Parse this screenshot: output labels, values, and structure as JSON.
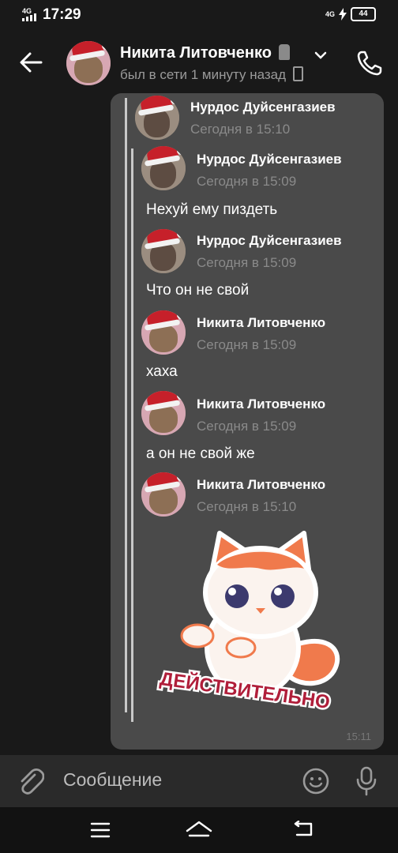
{
  "status_bar": {
    "time": "17:29",
    "network_left": "4G",
    "network_right": "4G",
    "battery": "44"
  },
  "header": {
    "contact_name": "Никита Литовченко",
    "contact_status": "был в сети 1 минуту назад",
    "back_icon": "arrow-left-icon",
    "call_icon": "phone-icon"
  },
  "forwarded": {
    "outer": {
      "author": "Нурдос Дуйсенгазиев",
      "date": "Сегодня в 15:10"
    },
    "messages": [
      {
        "author": "Нурдос Дуйсенгазиев",
        "date": "Сегодня в 15:09",
        "text": "Нехуй ему пиздеть"
      },
      {
        "author": "Нурдос Дуйсенгазиев",
        "date": "Сегодня в 15:09",
        "text": "Что он не свой"
      },
      {
        "author": "Никита Литовченко",
        "date": "Сегодня в 15:09",
        "text": "хаха"
      },
      {
        "author": "Никита Литовченко",
        "date": "Сегодня в 15:09",
        "text": "а он не свой же"
      },
      {
        "author": "Никита Литовченко",
        "date": "Сегодня в 15:10",
        "text": ""
      }
    ],
    "sticker_caption": "ДЕЙСТВИТЕЛЬНО"
  },
  "bubble_time": "15:11",
  "composer": {
    "placeholder": "Сообщение",
    "attach_icon": "paperclip-icon",
    "emoji_icon": "smile-icon",
    "mic_icon": "microphone-icon"
  },
  "navbar": {
    "menu_icon": "menu-icon",
    "home_icon": "home-icon",
    "back_icon": "return-icon"
  }
}
